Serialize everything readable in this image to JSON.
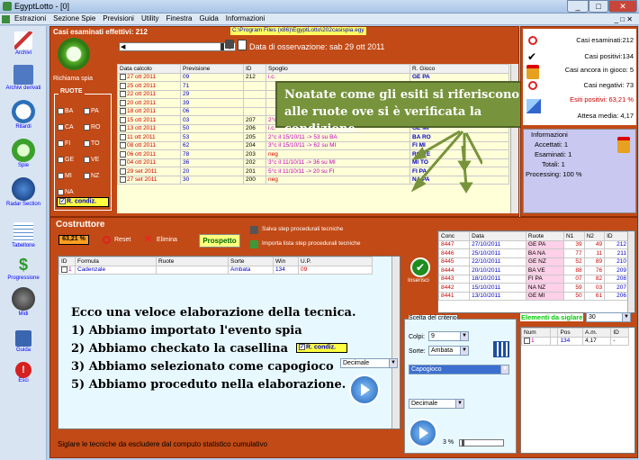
{
  "app": {
    "title": "EgyptLotto - [0]"
  },
  "menu": [
    "Estrazioni",
    "Sezione Spie",
    "Previsioni",
    "Utility",
    "Finestra",
    "Guida",
    "Informazioni"
  ],
  "sidebar": [
    {
      "label": "Archivi",
      "icon": "pencil-icon"
    },
    {
      "label": "Archivi derivati",
      "icon": "book-icon"
    },
    {
      "label": "Ritardi",
      "icon": "clock-icon"
    },
    {
      "label": "Spie",
      "icon": "spy-icon"
    },
    {
      "label": "Radar Section",
      "icon": "radar-icon"
    },
    {
      "label": "Tabellone",
      "icon": "calendar-icon"
    },
    {
      "label": "Progressione",
      "icon": "dollar-icon"
    },
    {
      "label": "Midi",
      "icon": "midi-icon"
    },
    {
      "label": "Guida",
      "icon": "help-book-icon"
    },
    {
      "label": "Esci",
      "icon": "exit-icon"
    }
  ],
  "top": {
    "casi_label": "Casi esaminati effettivi: 212",
    "path": "C:\\Program Files (x86)\\EgyptLotto\\202casispia.egy",
    "data_osservazione": "Data di osservazione:  sab 29 ott 2011",
    "richiama": "Richiama spia",
    "ruote_title": "RUOTE",
    "ruote": [
      [
        "BA",
        "PA"
      ],
      [
        "CA",
        "RO"
      ],
      [
        "FI",
        "TO"
      ],
      [
        "GE",
        "VE"
      ],
      [
        "MI",
        "NZ"
      ],
      [
        "NA",
        ""
      ]
    ],
    "rcondiz": "R. condiz.",
    "columns": [
      "Data calcolo",
      "Previsione",
      "ID",
      "Spoglio",
      "R. Gioco"
    ],
    "rows": [
      [
        "27 ott 2011",
        "09",
        "212",
        "i.c.",
        "GE PA"
      ],
      [
        "25 ott 2011",
        "71",
        "",
        "",
        ""
      ],
      [
        "22 ott 2011",
        "29",
        "",
        "",
        ""
      ],
      [
        "20 ott 2011",
        "39",
        "",
        "",
        ""
      ],
      [
        "18 ott 2011",
        "06",
        "",
        "",
        ""
      ],
      [
        "15 ott 2011",
        "03",
        "207",
        "2°c il 20/10/11 -> 03 su NZ",
        "NA NZ"
      ],
      [
        "13 ott 2011",
        "50",
        "206",
        "i.c.",
        "GE MI"
      ],
      [
        "11 ott 2011",
        "53",
        "205",
        "2°c il 15/10/11 -> 53 su BA",
        "BA RO"
      ],
      [
        "08 ott 2011",
        "62",
        "204",
        "3°c il 15/10/11 -> 62 su MI",
        "FI MI"
      ],
      [
        "06 ott 2011",
        "78",
        "203",
        "neg",
        "RO VE"
      ],
      [
        "04 ott 2011",
        "36",
        "202",
        "3°c il 11/10/11 -> 36 su MI",
        "MI TO"
      ],
      [
        "29 set 2011",
        "20",
        "201",
        "5°c il 11/10/11 -> 20 su FI",
        "FI PA"
      ],
      [
        "27 set 2011",
        "30",
        "200",
        "neg",
        "NA PA"
      ]
    ],
    "note": "Noatate come gli esiti si riferiscono alle ruote ove si è verificata la condizione."
  },
  "stats": {
    "esaminati": "Casi esaminati:212",
    "positivi": "Casi positivi:134",
    "in_gioco": "Casi ancora in gioco: 5",
    "negativi": "Casi negativi: 73",
    "esiti": "Esiti positivi: 63,21 %",
    "attesa": "Attesa media: 4,17",
    "info_title": "Informazioni",
    "accettati": "Accettati:  1",
    "esaminati2": "Esaminati:  1",
    "totali": "Totali:  1",
    "processing": "Processing:  100 %"
  },
  "costruttore": {
    "title": "Costruttore",
    "pct": "63,21 %",
    "reset": "Reset",
    "elimina": "Elimina",
    "prospetto": "Prospetto",
    "salva": "Salva step procedurali tecniche",
    "importa": "Importa lista step procedurali tecniche",
    "columns": [
      "ID",
      "Formula",
      "Ruote",
      "Sorte",
      "Win",
      "U.P."
    ],
    "row": [
      "1",
      "Cadenzale",
      "",
      "Ambata",
      "134",
      "09"
    ],
    "inserisci": "Inserisci",
    "lines": [
      "Ecco una veloce elaborazione della tecnica.",
      "1) Abbiamo importato l'evento spia",
      "2) Abbiamo checkato la casellina",
      "3) Abbiamo selezionato come capogioco",
      "5) Abbiamo proceduto nella elaborazione."
    ],
    "rcondiz": "R. condiz.",
    "decimale1": "Decimale",
    "footer": "Siglare le tecniche da escludere dal computo statistico cumulativo"
  },
  "conc": {
    "columns": [
      "Conc",
      "Data",
      "Ruote",
      "N1",
      "N2",
      "ID"
    ],
    "rows": [
      [
        "8447",
        "27/10/2011",
        "GE PA",
        "39",
        "49",
        "212"
      ],
      [
        "8446",
        "25/10/2011",
        "BA NA",
        "77",
        "11",
        "211"
      ],
      [
        "8445",
        "22/10/2011",
        "GE NZ",
        "52",
        "89",
        "210"
      ],
      [
        "8444",
        "20/10/2011",
        "BA VE",
        "88",
        "76",
        "209"
      ],
      [
        "8443",
        "18/10/2011",
        "FI PA",
        "07",
        "82",
        "208"
      ],
      [
        "8442",
        "15/10/2011",
        "NA NZ",
        "59",
        "03",
        "207"
      ],
      [
        "8441",
        "13/10/2011",
        "GE MI",
        "50",
        "61",
        "206"
      ]
    ]
  },
  "criterio": {
    "title": "Scelta del criterio",
    "colpi_label": "Colpi:",
    "colpi": "9",
    "sorte_label": "Sorte:",
    "sorte": "Ambata",
    "capogioco": "Capogioco",
    "decimale": "Decimale",
    "pct": "3 %"
  },
  "elementi": {
    "label": "Elementi da siglare",
    "value": "30",
    "columns": [
      "Num",
      "",
      "Pos",
      "A.m.",
      "ID"
    ],
    "row": [
      "1",
      "",
      "134",
      "4,17",
      "-"
    ]
  }
}
